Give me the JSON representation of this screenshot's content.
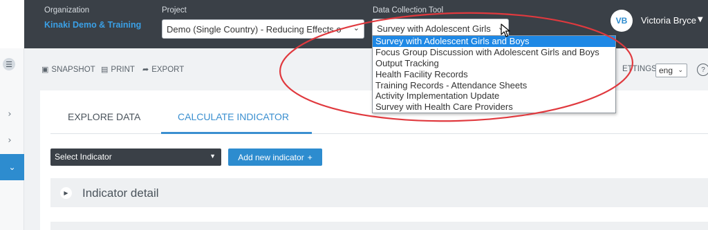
{
  "header": {
    "organization_label": "Organization",
    "organization_name": "Kinaki Demo & Training",
    "project_label": "Project",
    "project_value": "Demo (Single Country) - Reducing Effects o",
    "tool_label": "Data Collection Tool",
    "tool_value": "Survey with Adolescent Girls",
    "user_initials": "VB",
    "user_name": "Victoria Bryce"
  },
  "dropdown": {
    "options": [
      "Survey with Adolescent Girls and Boys",
      "Focus Group Discussion with Adolescent Girls and Boys",
      "Output Tracking",
      "Health Facility Records",
      "Training Records - Attendance Sheets",
      "Activity Implementation Update",
      "Survey with Health Care Providers"
    ],
    "selected_index": 0
  },
  "toolbar": {
    "snapshot": "SNAPSHOT",
    "print": "PRINT",
    "export": "EXPORT",
    "settings": "ETTINGS",
    "language": "eng"
  },
  "tabs": {
    "explore": "EXPLORE DATA",
    "calculate": "CALCULATE INDICATOR"
  },
  "indicator": {
    "select_placeholder": "Select Indicator",
    "add_button": "Add new indicator",
    "detail_title": "Indicator detail"
  },
  "colors": {
    "header_bg": "#3a4047",
    "accent": "#2d8ccf",
    "annotation": "#e0393e"
  }
}
